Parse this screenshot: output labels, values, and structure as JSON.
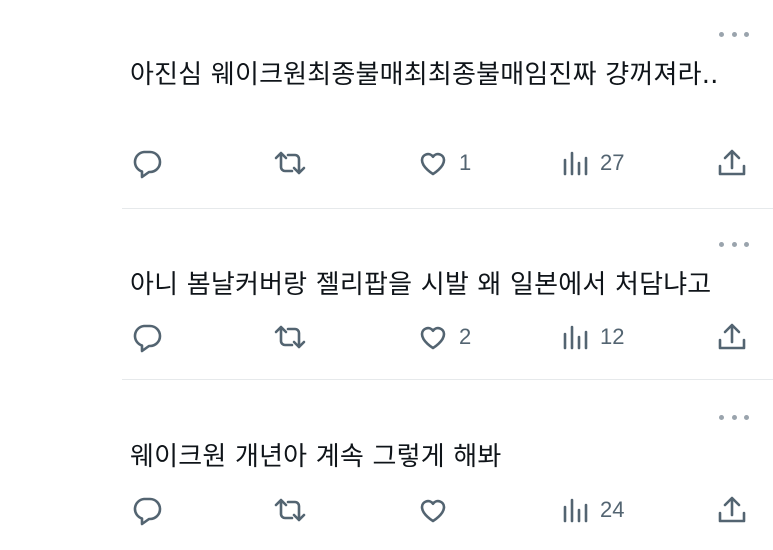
{
  "replies": [
    {
      "text": "아진심 웨이크원최종불매최최종불매임진짜 걍꺼져라..",
      "likes": "1",
      "views": "27"
    },
    {
      "text": "아니 봄날커버랑 젤리팝을 시발 왜 일본에서 처담냐고",
      "likes": "2",
      "views": "12"
    },
    {
      "text": "웨이크원 개년아 계속 그렇게 해봐",
      "likes": "",
      "views": "24"
    }
  ],
  "icons": {
    "reply": "speech-bubble-icon",
    "retweet": "retweet-arrows-icon",
    "like": "heart-icon",
    "views": "bar-chart-icon",
    "share": "share-upload-icon",
    "more": "ellipsis-icon"
  },
  "colors": {
    "text": "#0f1419",
    "muted": "#536471",
    "divider": "#e6e9eb"
  }
}
